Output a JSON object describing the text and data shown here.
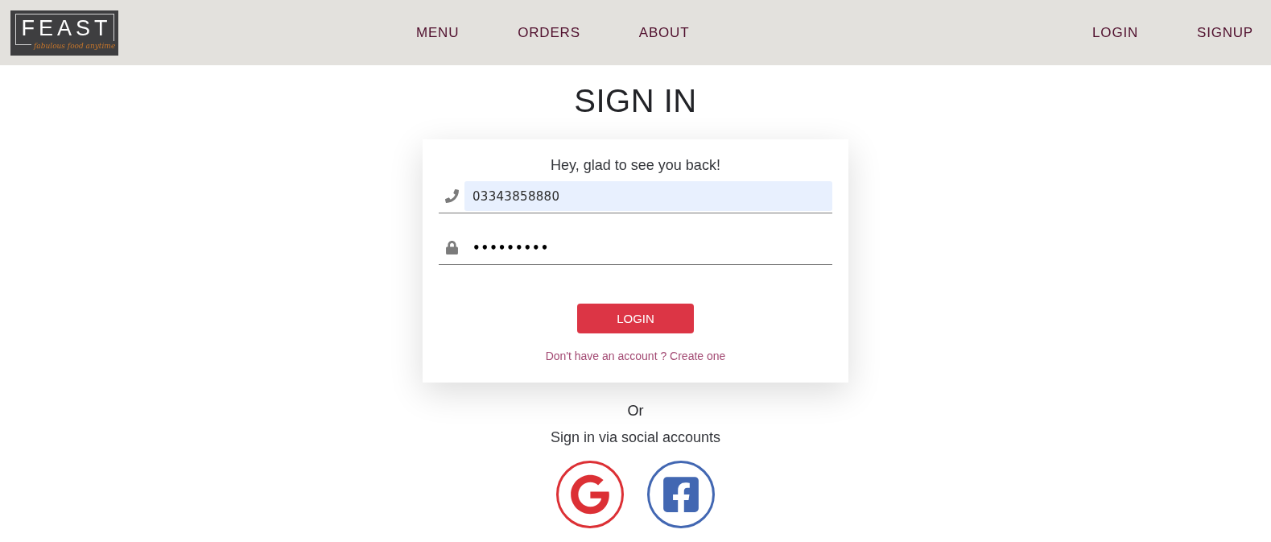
{
  "header": {
    "logo": {
      "title": "FEAST",
      "tagline": "fabulous food anytime"
    },
    "nav_links": [
      {
        "label": "MENU"
      },
      {
        "label": "ORDERS"
      },
      {
        "label": "ABOUT"
      }
    ],
    "account_links": [
      {
        "label": "LOGIN"
      },
      {
        "label": "SIGNUP"
      }
    ]
  },
  "page_title": "SIGN IN",
  "login_card": {
    "greeting": "Hey, glad to see you back!",
    "fields": [
      {
        "kind": "phone",
        "value": "03343858880",
        "autofilled": true
      },
      {
        "kind": "password",
        "value": "•••••••••",
        "autofilled": false
      }
    ],
    "submit_button": "LOGIN",
    "signup_prompt": "Don't have an account ? Create one"
  },
  "social": {
    "divider": "Or",
    "caption": "Sign in via social accounts",
    "providers": [
      {
        "kind": "google",
        "color": "#dc3035"
      },
      {
        "kind": "facebook",
        "color": "#4267b2"
      }
    ]
  }
}
